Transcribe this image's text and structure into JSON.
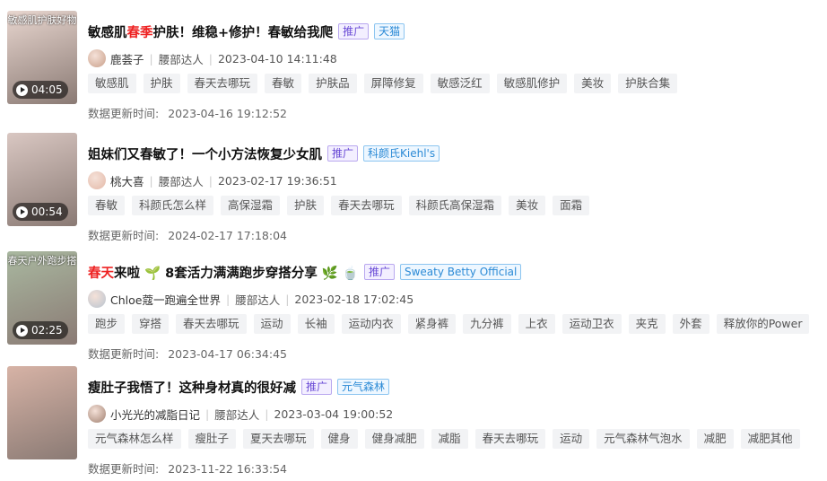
{
  "items": [
    {
      "thumb_overlay": "敏感肌护肤好物",
      "duration": "04:05",
      "title_parts": [
        {
          "text": "敏感肌",
          "red": false
        },
        {
          "text": "春季",
          "red": true
        },
        {
          "text": "护肤！维稳+修护！春敏给我爬",
          "red": false
        }
      ],
      "promo_label": "推广",
      "brand_label": "天猫",
      "author": "鹿荟子",
      "role": "腰部达人",
      "publish_time": "2023-04-10 14:11:48",
      "keywords": [
        "敏感肌",
        "护肤",
        "春天去哪玩",
        "春敏",
        "护肤品",
        "屏障修复",
        "敏感泛红",
        "敏感肌修护",
        "美妆",
        "护肤合集"
      ],
      "update_label": "数据更新时间:",
      "update_time": "2023-04-16 19:12:52",
      "thumb_color": "#e8d6cf",
      "avatar_color": "#c9a08a"
    },
    {
      "thumb_overlay": "",
      "duration": "00:54",
      "title_parts": [
        {
          "text": "姐妹们又春敏了！一个小方法恢复少女肌",
          "red": false
        }
      ],
      "promo_label": "推广",
      "brand_label": "科颜氏Kiehl's",
      "author": "桃大喜",
      "role": "腰部达人",
      "publish_time": "2023-02-17 19:36:51",
      "keywords": [
        "春敏",
        "科颜氏怎么样",
        "高保湿霜",
        "护肤",
        "春天去哪玩",
        "科颜氏高保湿霜",
        "美妆",
        "面霜"
      ],
      "update_label": "数据更新时间:",
      "update_time": "2024-02-17 17:18:04",
      "thumb_color": "#d9c7c2",
      "avatar_color": "#e3b9a8"
    },
    {
      "thumb_overlay": "春天户外跑步搭",
      "duration": "02:25",
      "title_parts": [
        {
          "text": "春天",
          "red": true
        },
        {
          "text": "来啦 🌱 8套活力满满跑步穿搭分享 🌿 🍵",
          "red": false
        }
      ],
      "promo_label": "推广",
      "brand_label": "Sweaty Betty Official",
      "author": "Chloe蔻一跑遍全世界",
      "role": "腰部达人",
      "publish_time": "2023-02-18 17:02:45",
      "keywords": [
        "跑步",
        "穿搭",
        "春天去哪玩",
        "运动",
        "长袖",
        "运动内衣",
        "紧身裤",
        "九分裤",
        "上衣",
        "运动卫衣",
        "夹克",
        "外套",
        "释放你的Power"
      ],
      "update_label": "数据更新时间:",
      "update_time": "2023-04-17 06:34:45",
      "thumb_color": "#a9b8a0",
      "avatar_color": "#b8c4d0"
    },
    {
      "thumb_overlay": "",
      "duration": "",
      "title_parts": [
        {
          "text": "瘦肚子我悟了！这种身材真的很好减",
          "red": false
        }
      ],
      "promo_label": "推广",
      "brand_label": "元气森林",
      "author": "小光光的减脂日记",
      "role": "腰部达人",
      "publish_time": "2023-03-04 19:00:52",
      "keywords": [
        "元气森林怎么样",
        "瘦肚子",
        "夏天去哪玩",
        "健身",
        "健身减肥",
        "减脂",
        "春天去哪玩",
        "运动",
        "元气森林气泡水",
        "减肥",
        "减肥其他"
      ],
      "update_label": "数据更新时间:",
      "update_time": "2023-11-22 16:33:54",
      "thumb_color": "#d7b3a6",
      "avatar_color": "#a08070"
    }
  ]
}
